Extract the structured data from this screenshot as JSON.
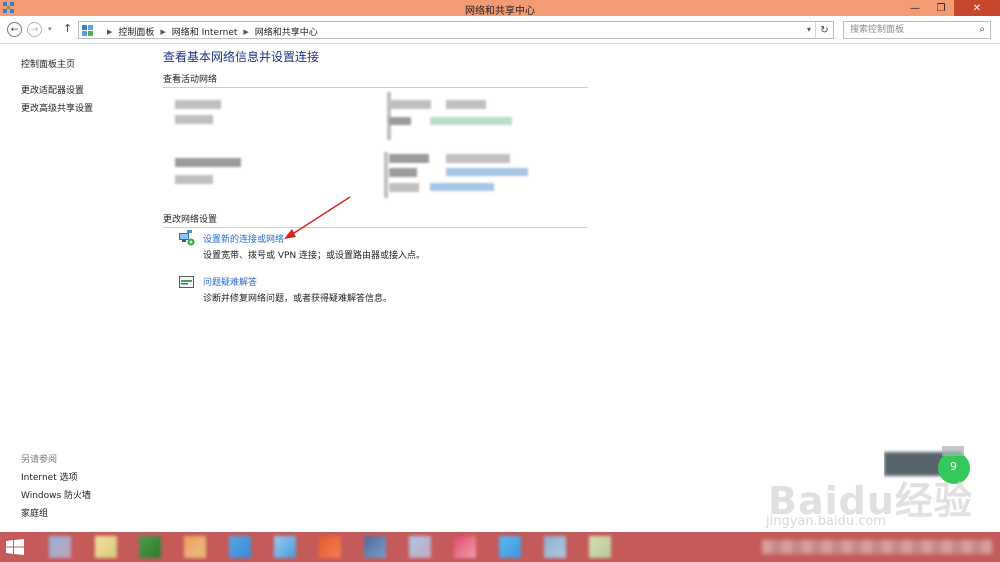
{
  "window": {
    "title": "网络和共享中心",
    "controls": [
      "minimize",
      "maximize",
      "close"
    ]
  },
  "address_bar": {
    "breadcrumbs": [
      "控制面板",
      "网络和 Internet",
      "网络和共享中心"
    ],
    "search_placeholder": "搜索控制面板"
  },
  "sidebar": {
    "items": [
      "控制面板主页",
      "更改适配器设置",
      "更改高级共享设置"
    ],
    "see_also_title": "另请参阅",
    "see_also_items": [
      "Internet 选项",
      "Windows 防火墙",
      "家庭组"
    ]
  },
  "main": {
    "title": "查看基本网络信息并设置连接",
    "active_networks_header": "查看活动网络",
    "change_settings_header": "更改网络设置",
    "tasks": [
      {
        "icon": "network-setup-icon",
        "link": "设置新的连接或网络",
        "desc": "设置宽带、拨号或 VPN 连接；或设置路由器或接入点。"
      },
      {
        "icon": "troubleshoot-icon",
        "link": "问题疑难解答",
        "desc": "诊断并修复网络问题，或者获得疑难解答信息。"
      }
    ]
  },
  "widget": {
    "value": "9"
  },
  "watermark": {
    "main": "Baidu经验",
    "sub": "jingyan.baidu.com"
  },
  "colors": {
    "titlebar": "#f39b73",
    "close": "#c7472d",
    "taskbar": "#c45a5a",
    "link": "#2a6bd1",
    "title": "#1e3287",
    "arrow": "#d9231e"
  }
}
